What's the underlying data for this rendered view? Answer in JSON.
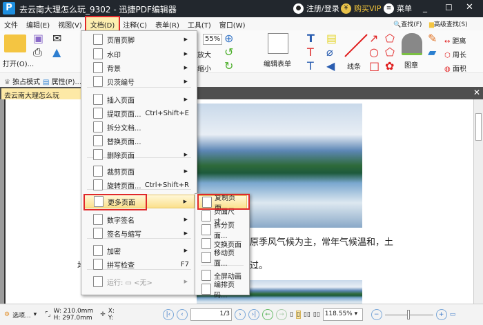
{
  "titlebar": {
    "title": "去云南大理怎么玩_9302 - 迅捷PDF编辑器",
    "login": "注册/登录",
    "vip": "购买VIP",
    "menu": "菜单"
  },
  "menubar": [
    "文件",
    "编辑(E)",
    "视图(V)",
    "文档(D)",
    "注释(C)",
    "表单(R)",
    "工具(T)",
    "窗口(W)"
  ],
  "toolbar": {
    "open": "打开(O)...",
    "zoom_in": "放大",
    "zoom_out": "缩小",
    "zoom_value": "55%",
    "edit_form": "编辑表单",
    "line": "线条",
    "stamp": "图章",
    "distance": "距离",
    "perimeter": "周长",
    "area": "面积",
    "find": "查找(F)",
    "advanced_find": "高级查找(S)"
  },
  "toolbar2": {
    "exclusive": "独占模式",
    "properties": "属性(P)..."
  },
  "tab": {
    "label": "去云南大理怎么玩_9302"
  },
  "menu": {
    "items": [
      {
        "label": "页眉页脚",
        "arrow": true
      },
      {
        "label": "水印",
        "arrow": true
      },
      {
        "label": "背景",
        "arrow": true
      },
      {
        "label": "贝茨编号",
        "arrow": true
      },
      {
        "label": "插入页面",
        "arrow": true
      },
      {
        "label": "提取页面...",
        "shortcut": "Ctrl+Shift+E"
      },
      {
        "label": "拆分文档..."
      },
      {
        "label": "替换页面..."
      },
      {
        "label": "删除页面",
        "arrow": true
      },
      {
        "label": "裁剪页面",
        "arrow": true
      },
      {
        "label": "旋转页面...",
        "shortcut": "Ctrl+Shift+R"
      },
      {
        "label": "更多页面",
        "arrow": true
      },
      {
        "label": "数字签名",
        "arrow": true
      },
      {
        "label": "签名与缩写",
        "arrow": true
      },
      {
        "label": "加密",
        "arrow": true
      },
      {
        "label": "拼写检查",
        "shortcut": "F7"
      },
      {
        "label": "运行: ▭ <无>",
        "arrow": true
      }
    ]
  },
  "submenu": {
    "items": [
      "复制页面...",
      "页面尺寸...",
      "拆分页面...",
      "交换页面",
      "移动页面...",
      "全屏动画",
      "编排页码..."
    ]
  },
  "document": {
    "line1": "原季风气候为主，常年气候温和，土",
    "line2_start": "地",
    "line2_end": "过。"
  },
  "status": {
    "options": "选项...",
    "width": "W: 210.0mm",
    "height": "H: 297.0mm",
    "x": "X:",
    "y": "Y:",
    "page": "1",
    "pages": "/3",
    "zoom": "118.55%"
  }
}
